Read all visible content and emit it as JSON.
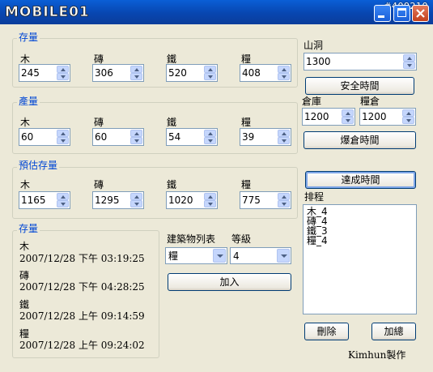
{
  "window": {
    "logo_text": "MOBILE01",
    "watermark": "#409210",
    "buttons": [
      "minimize",
      "maximize",
      "close"
    ]
  },
  "stock": {
    "title": "存量",
    "fields": [
      {
        "label": "木",
        "value": "245"
      },
      {
        "label": "磚",
        "value": "306"
      },
      {
        "label": "鐵",
        "value": "520"
      },
      {
        "label": "糧",
        "value": "408"
      }
    ]
  },
  "production": {
    "title": "產量",
    "fields": [
      {
        "label": "木",
        "value": "60"
      },
      {
        "label": "磚",
        "value": "60"
      },
      {
        "label": "鐵",
        "value": "54"
      },
      {
        "label": "糧",
        "value": "39"
      }
    ]
  },
  "estimate": {
    "title": "預估存量",
    "fields": [
      {
        "label": "木",
        "value": "1165"
      },
      {
        "label": "磚",
        "value": "1295"
      },
      {
        "label": "鐵",
        "value": "1020"
      },
      {
        "label": "糧",
        "value": "775"
      }
    ]
  },
  "stock_times": {
    "title": "存量",
    "items": [
      {
        "label": "木",
        "time": "2007/12/28 下午 03:19:25"
      },
      {
        "label": "磚",
        "time": "2007/12/28 下午 04:28:25"
      },
      {
        "label": "鐵",
        "time": "2007/12/28 上午 09:14:59"
      },
      {
        "label": "糧",
        "time": "2007/12/28 上午 09:24:02"
      }
    ]
  },
  "build": {
    "list_label": "建築物列表",
    "level_label": "等級",
    "building": "糧",
    "level": "4",
    "add_label": "加入"
  },
  "right": {
    "cave_label": "山洞",
    "cave_value": "1300",
    "safe_time_label": "安全時間",
    "warehouse_label": "倉庫",
    "granary_label": "糧倉",
    "warehouse_value": "1200",
    "granary_value": "1200",
    "overflow_label": "爆倉時間",
    "reach_label": "達成時間",
    "schedule_label": "排程",
    "schedule": [
      "木_4",
      "磚_4",
      "鐵_3",
      "糧_4"
    ],
    "delete_label": "刪除",
    "total_label": "加總",
    "credit": "Kimhun製作"
  },
  "colors": {
    "group_title": "#0046d5",
    "titlebar": "#0a5fd6",
    "background": "#ece9d8"
  }
}
